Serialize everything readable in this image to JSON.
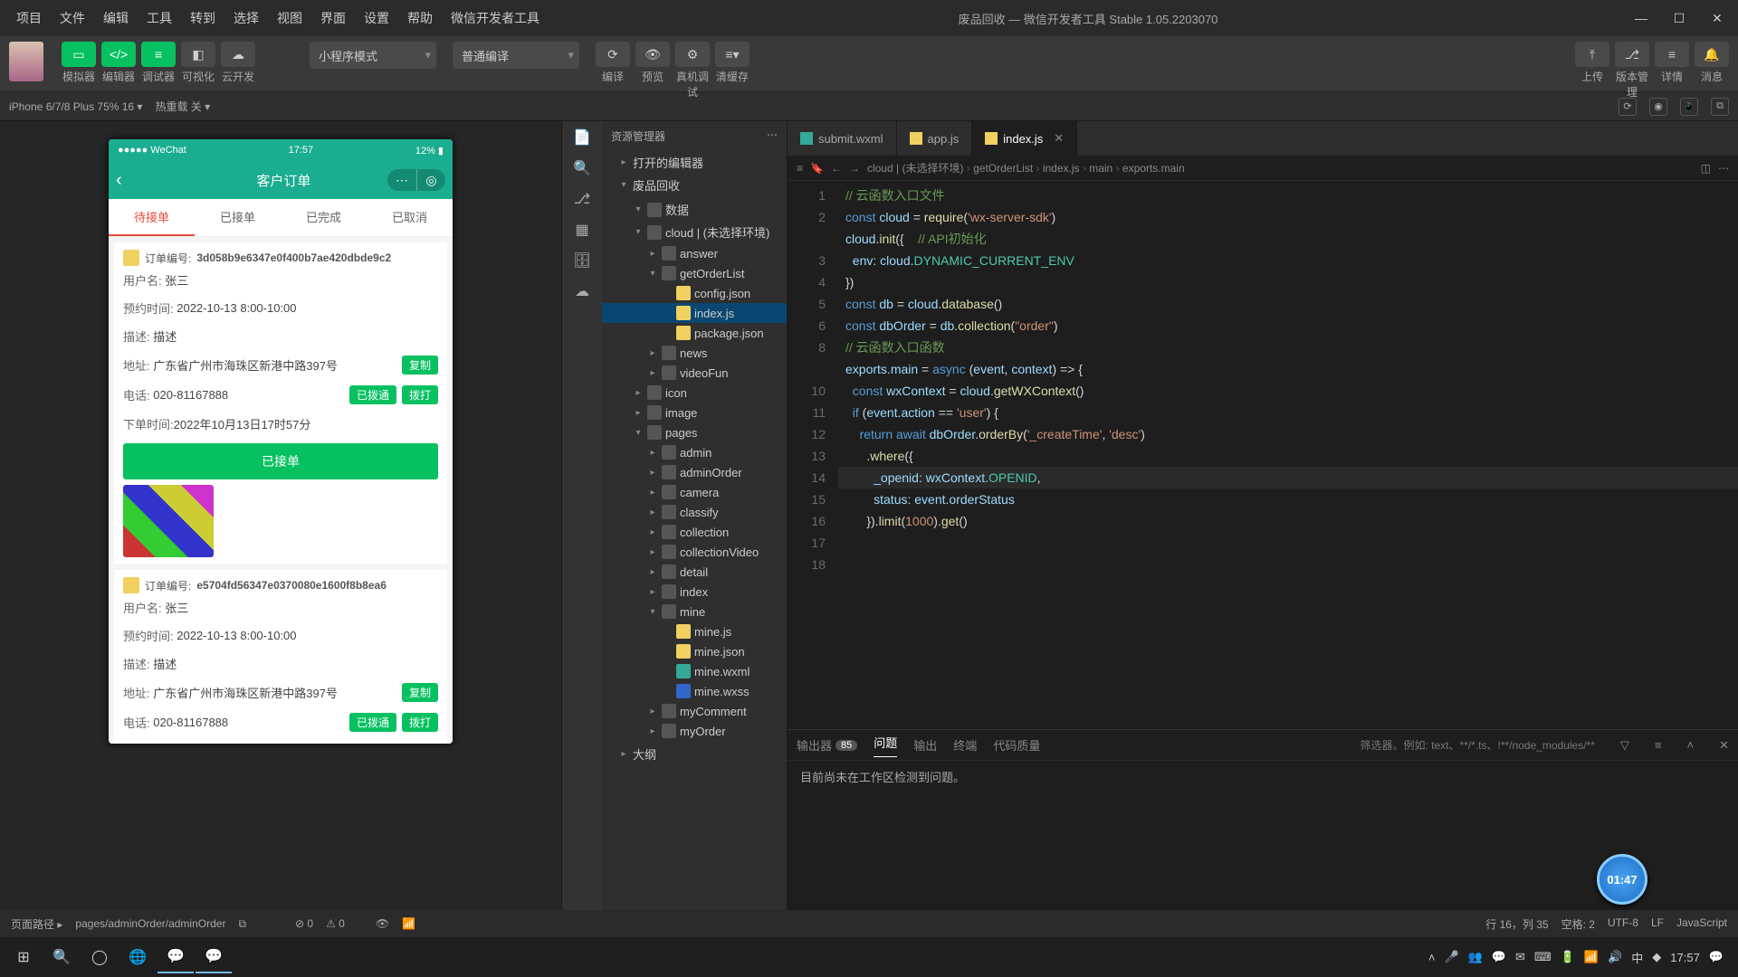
{
  "menubar": [
    "项目",
    "文件",
    "编辑",
    "工具",
    "转到",
    "选择",
    "视图",
    "界面",
    "设置",
    "帮助",
    "微信开发者工具"
  ],
  "title_center": "废品回收 — 微信开发者工具 Stable 1.05.2203070",
  "window_buttons": [
    "—",
    "☐",
    "✕"
  ],
  "toolbar": {
    "left_labels": [
      "模拟器",
      "编辑器",
      "调试器",
      "可视化",
      "云开发"
    ],
    "dropdown1": "小程序模式",
    "dropdown2": "普通编译",
    "mid_labels": [
      "编译",
      "预览",
      "真机调试",
      "清缓存"
    ],
    "right_labels": [
      "上传",
      "版本管理",
      "详情",
      "消息"
    ]
  },
  "devicebar": {
    "device": "iPhone 6/7/8 Plus 75% 16 ▾",
    "network": "热重载 关 ▾"
  },
  "phone": {
    "carrier": "●●●●● WeChat",
    "time_top": "17:57",
    "battery": "12% ▮",
    "back": "‹",
    "title": "客户订单",
    "tabs": [
      "待接单",
      "已接单",
      "已完成",
      "已取消"
    ],
    "orders": [
      {
        "id_label": "订单编号:",
        "id": "3d058b9e6347e0f400b7ae420dbde9c2",
        "user_label": "用户名:",
        "user": "张三",
        "time_label": "预约时间:",
        "time": "2022-10-13  8:00-10:00",
        "desc_label": "描述:",
        "desc": "描述",
        "addr_label": "地址:",
        "addr": "广东省广州市海珠区新港中路397号",
        "copy": "复制",
        "tel_label": "电话:",
        "tel": "020-81167888",
        "kf": "已拨通",
        "call": "拨打",
        "create_label": "下单时间:",
        "create": "2022年10月13日17时57分",
        "bigbtn": "已接单",
        "has_thumb": true
      },
      {
        "id_label": "订单编号:",
        "id": "e5704fd56347e0370080e1600f8b8ea6",
        "user_label": "用户名:",
        "user": "张三",
        "time_label": "预约时间:",
        "time": "2022-10-13  8:00-10:00",
        "desc_label": "描述:",
        "desc": "描述",
        "addr_label": "地址:",
        "addr": "广东省广州市海珠区新港中路397号",
        "copy": "复制",
        "tel_label": "电话:",
        "tel": "020-81167888",
        "kf": "已拨通",
        "call": "拨打"
      }
    ]
  },
  "explorer": {
    "title": "资源管理器",
    "sections": [
      "打开的编辑器",
      "废品回收"
    ],
    "tree": [
      {
        "ind": 2,
        "arrow": "▾",
        "icon": "folder",
        "label": "数据"
      },
      {
        "ind": 2,
        "arrow": "▾",
        "icon": "folder",
        "label": "cloud | (未选择环境)"
      },
      {
        "ind": 3,
        "arrow": "▸",
        "icon": "folder",
        "label": "answer"
      },
      {
        "ind": 3,
        "arrow": "▾",
        "icon": "folder",
        "label": "getOrderList"
      },
      {
        "ind": 4,
        "arrow": "",
        "icon": "json",
        "label": "config.json"
      },
      {
        "ind": 4,
        "arrow": "",
        "icon": "js",
        "label": "index.js",
        "sel": true
      },
      {
        "ind": 4,
        "arrow": "",
        "icon": "json",
        "label": "package.json"
      },
      {
        "ind": 3,
        "arrow": "▸",
        "icon": "folder",
        "label": "news"
      },
      {
        "ind": 3,
        "arrow": "▸",
        "icon": "folder",
        "label": "videoFun"
      },
      {
        "ind": 2,
        "arrow": "▸",
        "icon": "folder",
        "label": "icon"
      },
      {
        "ind": 2,
        "arrow": "▸",
        "icon": "folder",
        "label": "image"
      },
      {
        "ind": 2,
        "arrow": "▾",
        "icon": "folder",
        "label": "pages"
      },
      {
        "ind": 3,
        "arrow": "▸",
        "icon": "folder",
        "label": "admin"
      },
      {
        "ind": 3,
        "arrow": "▸",
        "icon": "folder",
        "label": "adminOrder"
      },
      {
        "ind": 3,
        "arrow": "▸",
        "icon": "folder",
        "label": "camera"
      },
      {
        "ind": 3,
        "arrow": "▸",
        "icon": "folder",
        "label": "classify"
      },
      {
        "ind": 3,
        "arrow": "▸",
        "icon": "folder",
        "label": "collection"
      },
      {
        "ind": 3,
        "arrow": "▸",
        "icon": "folder",
        "label": "collectionVideo"
      },
      {
        "ind": 3,
        "arrow": "▸",
        "icon": "folder",
        "label": "detail"
      },
      {
        "ind": 3,
        "arrow": "▸",
        "icon": "folder",
        "label": "index"
      },
      {
        "ind": 3,
        "arrow": "▾",
        "icon": "folder",
        "label": "mine"
      },
      {
        "ind": 4,
        "arrow": "",
        "icon": "js",
        "label": "mine.js"
      },
      {
        "ind": 4,
        "arrow": "",
        "icon": "json",
        "label": "mine.json"
      },
      {
        "ind": 4,
        "arrow": "",
        "icon": "wxml",
        "label": "mine.wxml"
      },
      {
        "ind": 4,
        "arrow": "",
        "icon": "wxss",
        "label": "mine.wxss"
      },
      {
        "ind": 3,
        "arrow": "▸",
        "icon": "folder",
        "label": "myComment"
      },
      {
        "ind": 3,
        "arrow": "▸",
        "icon": "folder",
        "label": "myOrder"
      }
    ],
    "outline": "大纲"
  },
  "editor_tabs": [
    {
      "icon": "wxml",
      "label": "submit.wxml"
    },
    {
      "icon": "js",
      "label": "app.js"
    },
    {
      "icon": "js",
      "label": "index.js",
      "active": true,
      "close": "✕"
    }
  ],
  "breadcrumb": [
    "cloud | (未选择环境)",
    "getOrderList",
    "index.js",
    "main",
    "exports.main"
  ],
  "code_lines": [
    {
      "n": "1",
      "h": "<span class='cm'>// 云函数入口文件</span>"
    },
    {
      "n": "2",
      "h": "<span class='kw'>const</span> <span class='prop'>cloud</span> = <span class='fn'>require</span>(<span class='str'>'wx-server-sdk'</span>)"
    },
    {
      "n": "",
      "h": ""
    },
    {
      "n": "3",
      "h": "<span class='prop'>cloud</span>.<span class='fn'>init</span>({    <span class='cm'>// API初始化</span>"
    },
    {
      "n": "4",
      "h": "  <span class='prop'>env</span>: <span class='prop'>cloud</span>.<span class='cls'>DYNAMIC_CURRENT_ENV</span>"
    },
    {
      "n": "5",
      "h": "})"
    },
    {
      "n": "6",
      "h": "<span class='kw'>const</span> <span class='prop'>db</span> = <span class='prop'>cloud</span>.<span class='fn'>database</span>()"
    },
    {
      "n": "8",
      "h": "<span class='kw'>const</span> <span class='prop'>dbOrder</span> = <span class='prop'>db</span>.<span class='fn'>collection</span>(<span class='str'>\"order\"</span>)"
    },
    {
      "n": "",
      "h": ""
    },
    {
      "n": "10",
      "h": "<span class='cm'>// 云函数入口函数</span>"
    },
    {
      "n": "11",
      "h": "<span class='prop'>exports</span>.<span class='prop'>main</span> = <span class='kw'>async</span> (<span class='prop'>event</span>, <span class='prop'>context</span>) =&gt; {"
    },
    {
      "n": "12",
      "h": "  <span class='kw'>const</span> <span class='prop'>wxContext</span> = <span class='prop'>cloud</span>.<span class='fn'>getWXContext</span>()"
    },
    {
      "n": "13",
      "h": "  <span class='kw'>if</span> (<span class='prop'>event</span>.<span class='prop'>action</span> == <span class='str'>'user'</span>) {"
    },
    {
      "n": "14",
      "h": "    <span class='kw'>return await</span> <span class='prop'>dbOrder</span>.<span class='fn'>orderBy</span>(<span class='str'>'_createTime'</span>, <span class='str'>'desc'</span>)"
    },
    {
      "n": "15",
      "h": "      .<span class='fn'>where</span>({"
    },
    {
      "n": "16",
      "h": "        <span class='prop'>_openid</span>: <span class='prop'>wxContext</span>.<span class='cls'>OPENID</span>,",
      "cur": true
    },
    {
      "n": "17",
      "h": "        <span class='prop'>status</span>: <span class='prop'>event</span>.<span class='prop'>orderStatus</span>"
    },
    {
      "n": "18",
      "h": "      }).<span class='fn'>limit</span>(<span class='str'>1000</span>).<span class='fn'>get</span>()"
    }
  ],
  "panel": {
    "tabs": [
      {
        "label": "输出器",
        "badge": "85"
      },
      {
        "label": "问题",
        "active": true
      },
      {
        "label": "输出"
      },
      {
        "label": "终端"
      },
      {
        "label": "代码质量"
      }
    ],
    "filter": "筛选器。例如: text、**/*.ts、!**/node_modules/**",
    "body": "目前尚未在工作区检测到问题。"
  },
  "statusbar": {
    "left": [
      "页面路径 ▸",
      "pages/adminOrder/adminOrder"
    ],
    "mid": [
      "⊘ 0",
      "⚠ 0"
    ],
    "right": [
      "行 16，列 35",
      "空格: 2",
      "UTF-8",
      "LF",
      "JavaScript"
    ]
  },
  "timer": "01:47",
  "taskbar": {
    "time": "17:57",
    "date": ""
  }
}
